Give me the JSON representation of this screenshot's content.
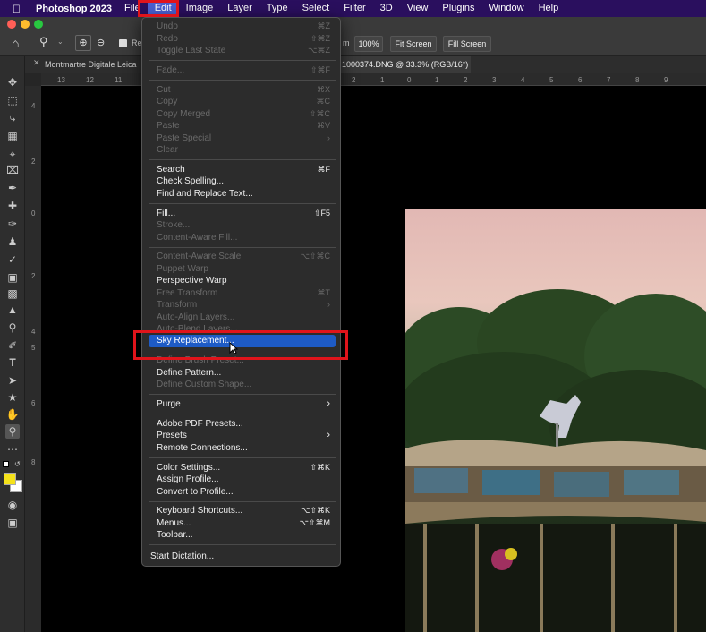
{
  "menubar": {
    "apple": "",
    "app": "Photoshop 2023",
    "items": [
      "File",
      "Edit",
      "Image",
      "Layer",
      "Type",
      "Select",
      "Filter",
      "3D",
      "View",
      "Plugins",
      "Window",
      "Help"
    ],
    "active": "Edit"
  },
  "options_bar": {
    "zoom_pct": "100%",
    "fit_screen": "Fit Screen",
    "fill_screen": "Fill Screen",
    "partial_label": "Re",
    "partial_label2": "m"
  },
  "tabs": [
    {
      "label": "Montmartre Digitale Leica"
    },
    {
      "label": "1000374.DNG @ 33.3% (RGB/16*)"
    }
  ],
  "ruler_top": [
    "13",
    "12",
    "11",
    "2",
    "1",
    "0",
    "1",
    "2",
    "3",
    "4",
    "5",
    "6",
    "7",
    "8",
    "9"
  ],
  "ruler_left": [
    "4",
    "2",
    "0",
    "2",
    "4",
    "5",
    "6",
    "8"
  ],
  "edit_menu": {
    "undo": {
      "label": "Undo",
      "sc": "⌘Z"
    },
    "redo": {
      "label": "Redo",
      "sc": "⇧⌘Z"
    },
    "toggle": {
      "label": "Toggle Last State",
      "sc": "⌥⌘Z"
    },
    "fade": {
      "label": "Fade...",
      "sc": "⇧⌘F"
    },
    "cut": {
      "label": "Cut",
      "sc": "⌘X"
    },
    "copy": {
      "label": "Copy",
      "sc": "⌘C"
    },
    "copy_merged": {
      "label": "Copy Merged",
      "sc": "⇧⌘C"
    },
    "paste": {
      "label": "Paste",
      "sc": "⌘V"
    },
    "paste_special": {
      "label": "Paste Special",
      "sc": "›"
    },
    "clear": {
      "label": "Clear"
    },
    "search": {
      "label": "Search",
      "sc": "⌘F"
    },
    "check_spelling": {
      "label": "Check Spelling..."
    },
    "find_replace": {
      "label": "Find and Replace Text..."
    },
    "fill": {
      "label": "Fill...",
      "sc": "⇧F5"
    },
    "stroke": {
      "label": "Stroke..."
    },
    "content_aware_fill": {
      "label": "Content-Aware Fill..."
    },
    "content_aware_scale": {
      "label": "Content-Aware Scale",
      "sc": "⌥⇧⌘C"
    },
    "puppet_warp": {
      "label": "Puppet Warp"
    },
    "perspective_warp": {
      "label": "Perspective Warp"
    },
    "free_transform": {
      "label": "Free Transform",
      "sc": "⌘T"
    },
    "transform": {
      "label": "Transform",
      "sc": "›"
    },
    "auto_align": {
      "label": "Auto-Align Layers..."
    },
    "auto_blend": {
      "label": "Auto-Blend Layers..."
    },
    "sky_replacement": {
      "label": "Sky Replacement..."
    },
    "define_brush": {
      "label": "Define Brush Preset..."
    },
    "define_pattern": {
      "label": "Define Pattern..."
    },
    "define_shape": {
      "label": "Define Custom Shape..."
    },
    "purge": {
      "label": "Purge",
      "sc": "›"
    },
    "pdf_presets": {
      "label": "Adobe PDF Presets..."
    },
    "presets": {
      "label": "Presets",
      "sc": "›"
    },
    "remote": {
      "label": "Remote Connections..."
    },
    "color_settings": {
      "label": "Color Settings...",
      "sc": "⇧⌘K"
    },
    "assign_profile": {
      "label": "Assign Profile..."
    },
    "convert_profile": {
      "label": "Convert to Profile..."
    },
    "keyboard_shortcuts": {
      "label": "Keyboard Shortcuts...",
      "sc": "⌥⇧⌘K"
    },
    "menus": {
      "label": "Menus...",
      "sc": "⌥⇧⌘M"
    },
    "toolbar": {
      "label": "Toolbar..."
    },
    "dictation": {
      "label": "Start Dictation..."
    }
  },
  "colors": {
    "menubar": "#2a0f5e",
    "highlight": "#1e5bc6",
    "annotation": "#e0141b",
    "foreground_swatch": "#f5e21a"
  }
}
